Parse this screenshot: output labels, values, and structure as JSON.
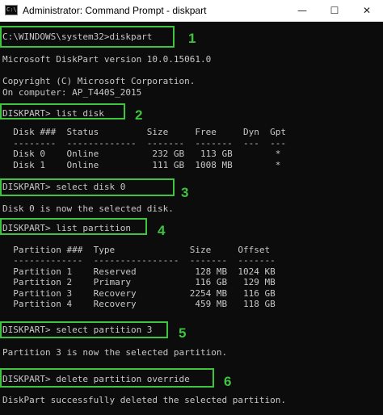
{
  "window": {
    "title": "Administrator: Command Prompt - diskpart",
    "icon_label": "C:\\",
    "minimize_glyph": "—",
    "maximize_glyph": "☐",
    "close_glyph": "✕"
  },
  "console": {
    "lines": [
      "C:\\WINDOWS\\system32>diskpart",
      "Microsoft DiskPart version 10.0.15061.0",
      "Copyright (C) Microsoft Corporation.",
      "On computer: AP_T440S_2015",
      "DISKPART> list disk",
      "  Disk ###  Status         Size     Free     Dyn  Gpt",
      "  --------  -------------  -------  -------  ---  ---",
      "  Disk 0    Online          232 GB   113 GB        *",
      "  Disk 1    Online          111 GB  1008 MB        *",
      "DISKPART> select disk 0",
      "Disk 0 is now the selected disk.",
      "DISKPART> list partition",
      "  Partition ###  Type              Size     Offset",
      "  -------------  ----------------  -------  -------",
      "  Partition 1    Reserved           128 MB  1024 KB",
      "  Partition 2    Primary            116 GB   129 MB",
      "  Partition 3    Recovery          2254 MB   116 GB",
      "  Partition 4    Recovery           459 MB   118 GB",
      "DISKPART> select partition 3",
      "Partition 3 is now the selected partition.",
      "DISKPART> delete partition override",
      "DiskPart successfully deleted the selected partition."
    ],
    "step_labels": [
      "1",
      "2",
      "3",
      "4",
      "5",
      "6"
    ]
  },
  "colors": {
    "console_background": "#0c0c0c",
    "console_text": "#c8c8c8",
    "highlight": "#3ec43e"
  }
}
